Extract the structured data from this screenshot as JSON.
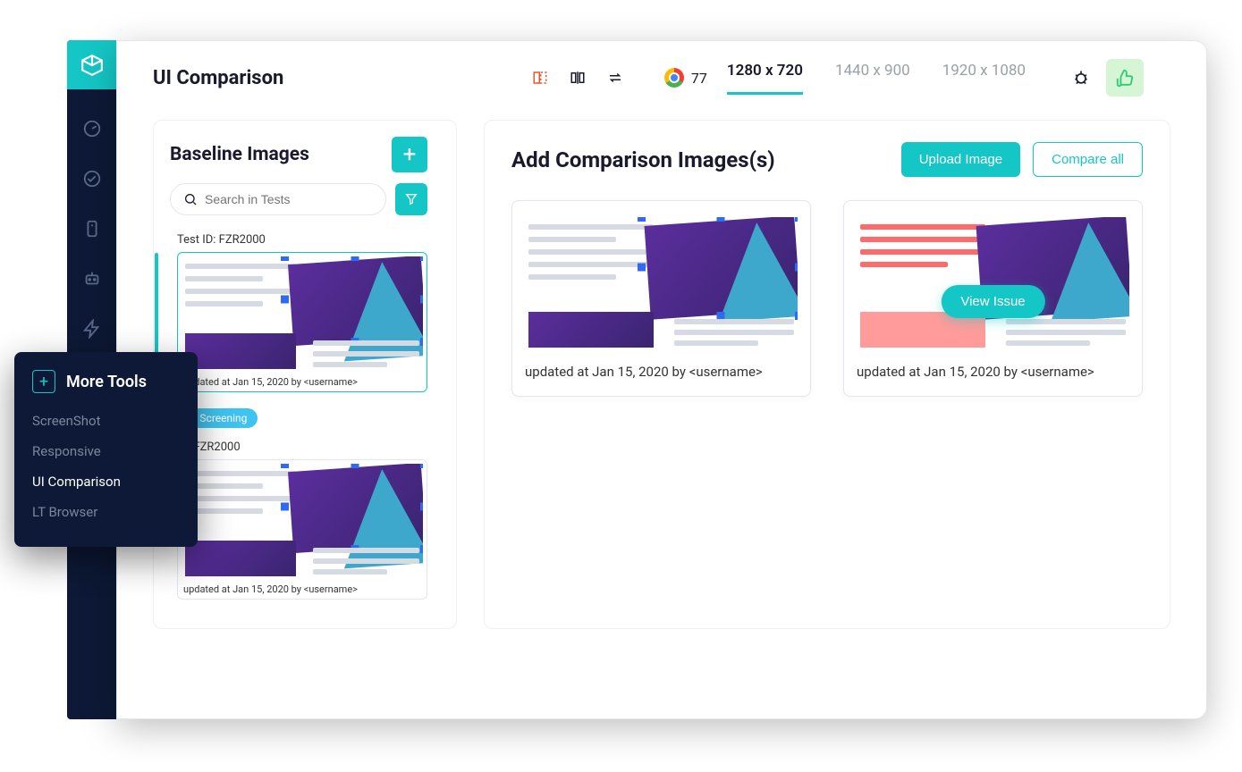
{
  "page_title": "UI Comparison",
  "browser": {
    "name": "Chrome",
    "version": "77"
  },
  "resolutions": [
    {
      "label": "1280 x 720",
      "active": true
    },
    {
      "label": "1440 x 900",
      "active": false
    },
    {
      "label": "1920 x 1080",
      "active": false
    }
  ],
  "baseline": {
    "title": "Baseline Images",
    "search_placeholder": "Search in Tests",
    "tests": [
      {
        "id_label": "Test ID: FZR2000",
        "meta": "updated at Jan 15, 2020 by <username>",
        "active": true
      },
      {
        "tag": "er Screening",
        "id_label": "ID: FZR2000",
        "meta": "updated at Jan 15, 2020 by <username>",
        "active": false
      }
    ]
  },
  "comparison": {
    "title": "Add Comparison Images(s)",
    "upload_label": "Upload Image",
    "compare_label": "Compare all",
    "cards": [
      {
        "meta": "updated at Jan 15, 2020 by <username>",
        "has_issue": false
      },
      {
        "meta": "updated at Jan 15, 2020 by <username>",
        "has_issue": true,
        "issue_label": "View Issue"
      }
    ]
  },
  "popup": {
    "title": "More Tools",
    "items": [
      {
        "label": "ScreenShot",
        "active": false
      },
      {
        "label": "Responsive",
        "active": false
      },
      {
        "label": "UI Comparison",
        "active": true
      },
      {
        "label": "LT Browser",
        "active": false
      }
    ]
  }
}
